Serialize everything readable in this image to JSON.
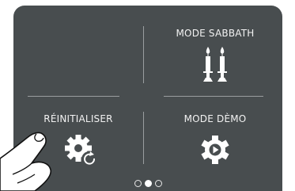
{
  "tiles": {
    "sabbath": {
      "label": "MODE SABBATH",
      "icon": "candles-icon"
    },
    "reset": {
      "label": "RÉINITIALISER",
      "icon": "reset-gear-icon"
    },
    "demo": {
      "label": "MODE DÈMO",
      "icon": "play-gear-icon"
    }
  },
  "pagination": {
    "pages": 3,
    "active_page": 2
  },
  "colors": {
    "panel_background": "#484d4f",
    "divider": "#9a9ea0",
    "text": "#f2f2f2"
  }
}
